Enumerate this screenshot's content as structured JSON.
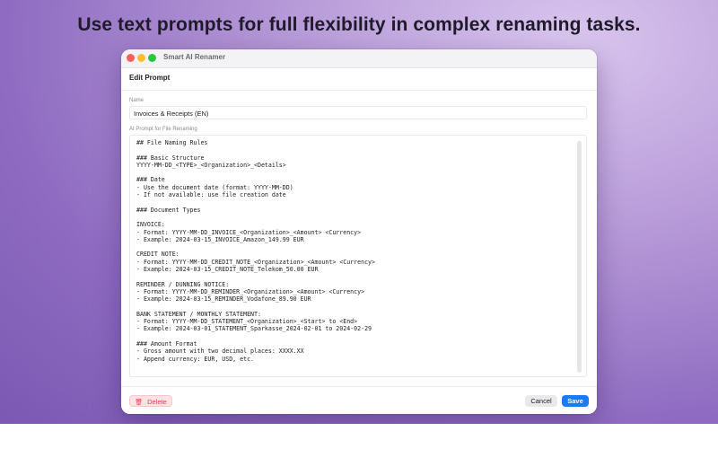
{
  "headline": "Use text prompts for full flexibility in complex renaming tasks.",
  "window": {
    "title": "Smart AI Renamer",
    "section_title": "Edit Prompt"
  },
  "form": {
    "name_label": "Name",
    "name_value": "Invoices & Receipts (EN)",
    "prompt_label": "AI Prompt for File Renaming",
    "prompt_value": "## File Naming Rules\n\n### Basic Structure\nYYYY-MM-DD_<TYPE>_<Organization>_<Details>\n\n### Date\n- Use the document date (format: YYYY-MM-DD)\n- If not available: use file creation date\n\n### Document Types\n\nINVOICE:\n- Format: YYYY-MM-DD_INVOICE_<Organization>_<Amount> <Currency>\n- Example: 2024-03-15_INVOICE_Amazon_149.99 EUR\n\nCREDIT NOTE:\n- Format: YYYY-MM-DD_CREDIT_NOTE_<Organization>_<Amount> <Currency>\n- Example: 2024-03-15_CREDIT_NOTE_Telekom_50.00 EUR\n\nREMINDER / DUNNING NOTICE:\n- Format: YYYY-MM-DD_REMINDER_<Organization>_<Amount> <Currency>\n- Example: 2024-03-15_REMINDER_Vodafone_89.90 EUR\n\nBANK STATEMENT / MONTHLY STATEMENT:\n- Format: YYYY-MM-DD_STATEMENT_<Organization>_<Start> to <End>\n- Example: 2024-03-01_STATEMENT_Sparkasse_2024-02-01 to 2024-02-29\n\n### Amount Format\n- Gross amount with two decimal places: XXXX.XX\n- Append currency: EUR, USD, etc."
  },
  "footer": {
    "delete_label": "Delete",
    "delete_icon": "trash-icon",
    "cancel_label": "Cancel",
    "save_label": "Save"
  },
  "colors": {
    "accent": "#1a7cf5",
    "danger": "#e0434f"
  }
}
